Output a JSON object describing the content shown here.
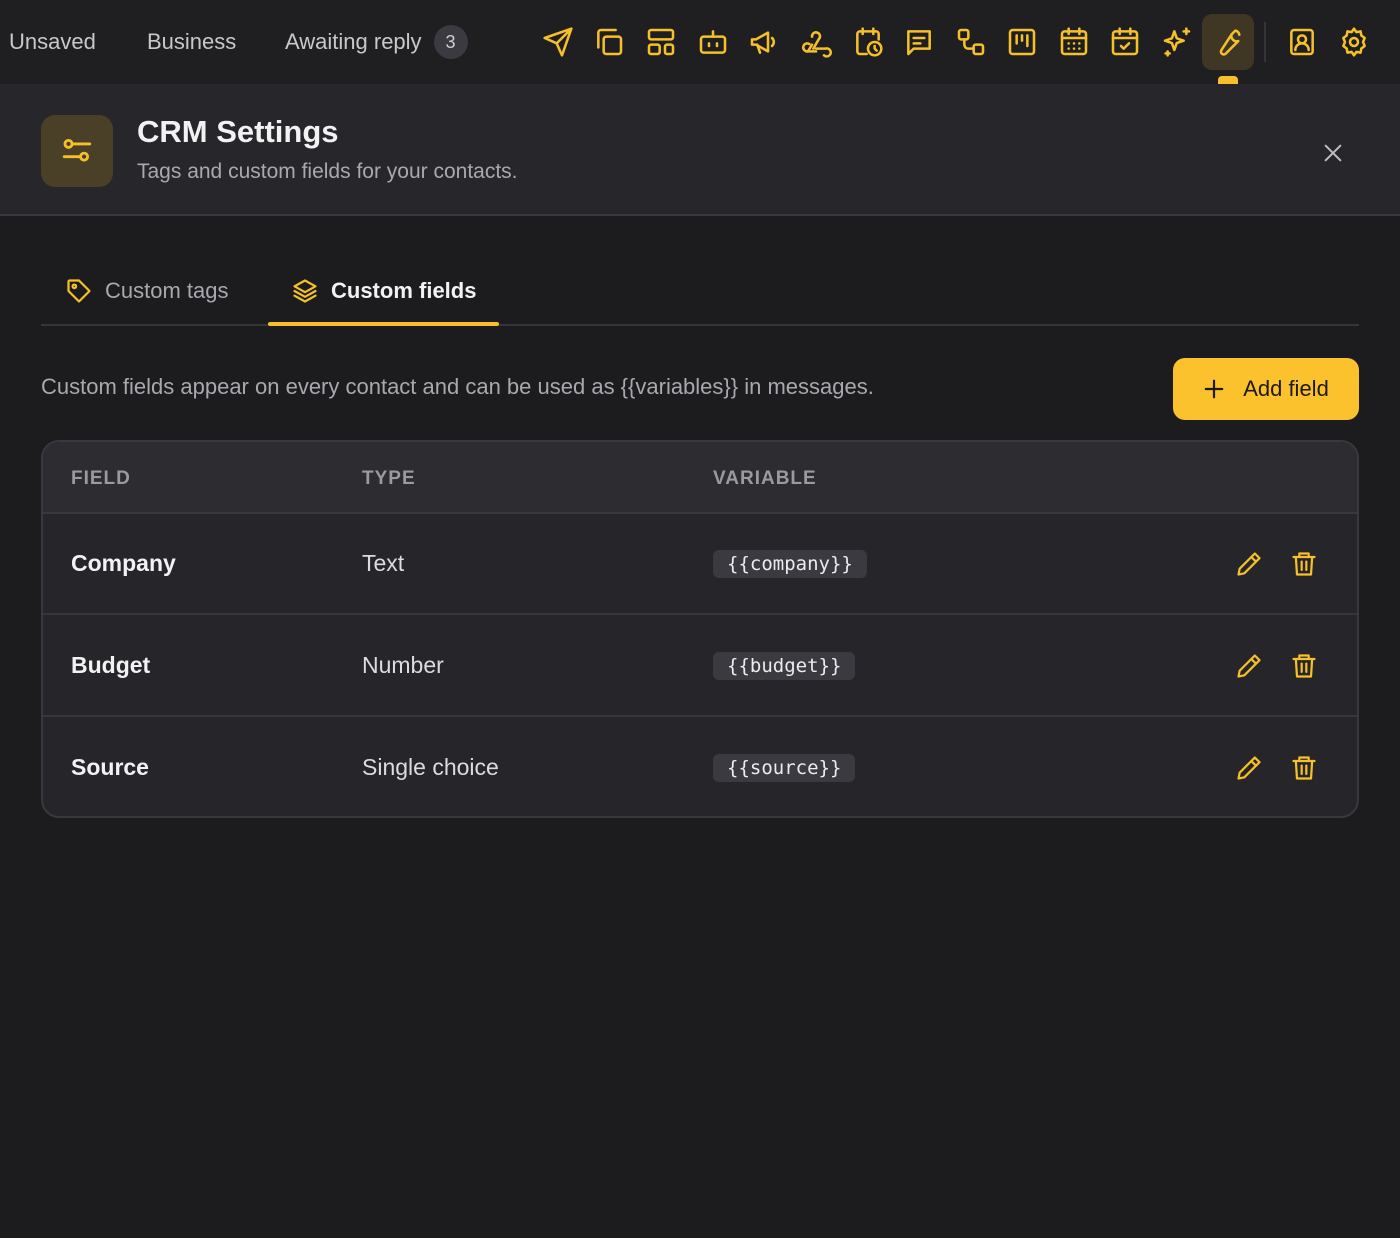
{
  "topbar": {
    "tabs": [
      {
        "label": "Unsaved"
      },
      {
        "label": "Business"
      },
      {
        "label": "Awaiting reply",
        "badge": "3"
      }
    ],
    "icons": [
      "send-icon",
      "copy-icon",
      "layout-icon",
      "bot-icon",
      "megaphone-icon",
      "webhook-icon",
      "calendar-clock-icon",
      "message-icon",
      "workflow-icon",
      "kanban-icon",
      "calendar-icon",
      "calendar-check-icon",
      "sparkles-icon",
      "wrench-icon",
      "contact-icon",
      "gear-icon"
    ],
    "active_icon": "wrench-icon"
  },
  "header": {
    "title": "CRM Settings",
    "subtitle": "Tags and custom fields for your contacts."
  },
  "tabs": {
    "items": [
      {
        "label": "Custom tags",
        "icon": "tag-icon"
      },
      {
        "label": "Custom fields",
        "icon": "layers-icon"
      }
    ],
    "active": "Custom fields"
  },
  "description": "Custom fields appear on every contact and can be used as {{variables}} in messages.",
  "add_button": {
    "label": "Add field"
  },
  "table": {
    "headers": [
      "FIELD",
      "TYPE",
      "VARIABLE"
    ],
    "rows": [
      {
        "field": "Company",
        "type": "Text",
        "variable": "{{company}}"
      },
      {
        "field": "Budget",
        "type": "Number",
        "variable": "{{budget}}"
      },
      {
        "field": "Source",
        "type": "Single choice",
        "variable": "{{source}}"
      }
    ]
  },
  "colors": {
    "accent": "#f5c029",
    "button": "#fcc22d",
    "background": "#1c1c1f",
    "panel": "#26262a"
  }
}
